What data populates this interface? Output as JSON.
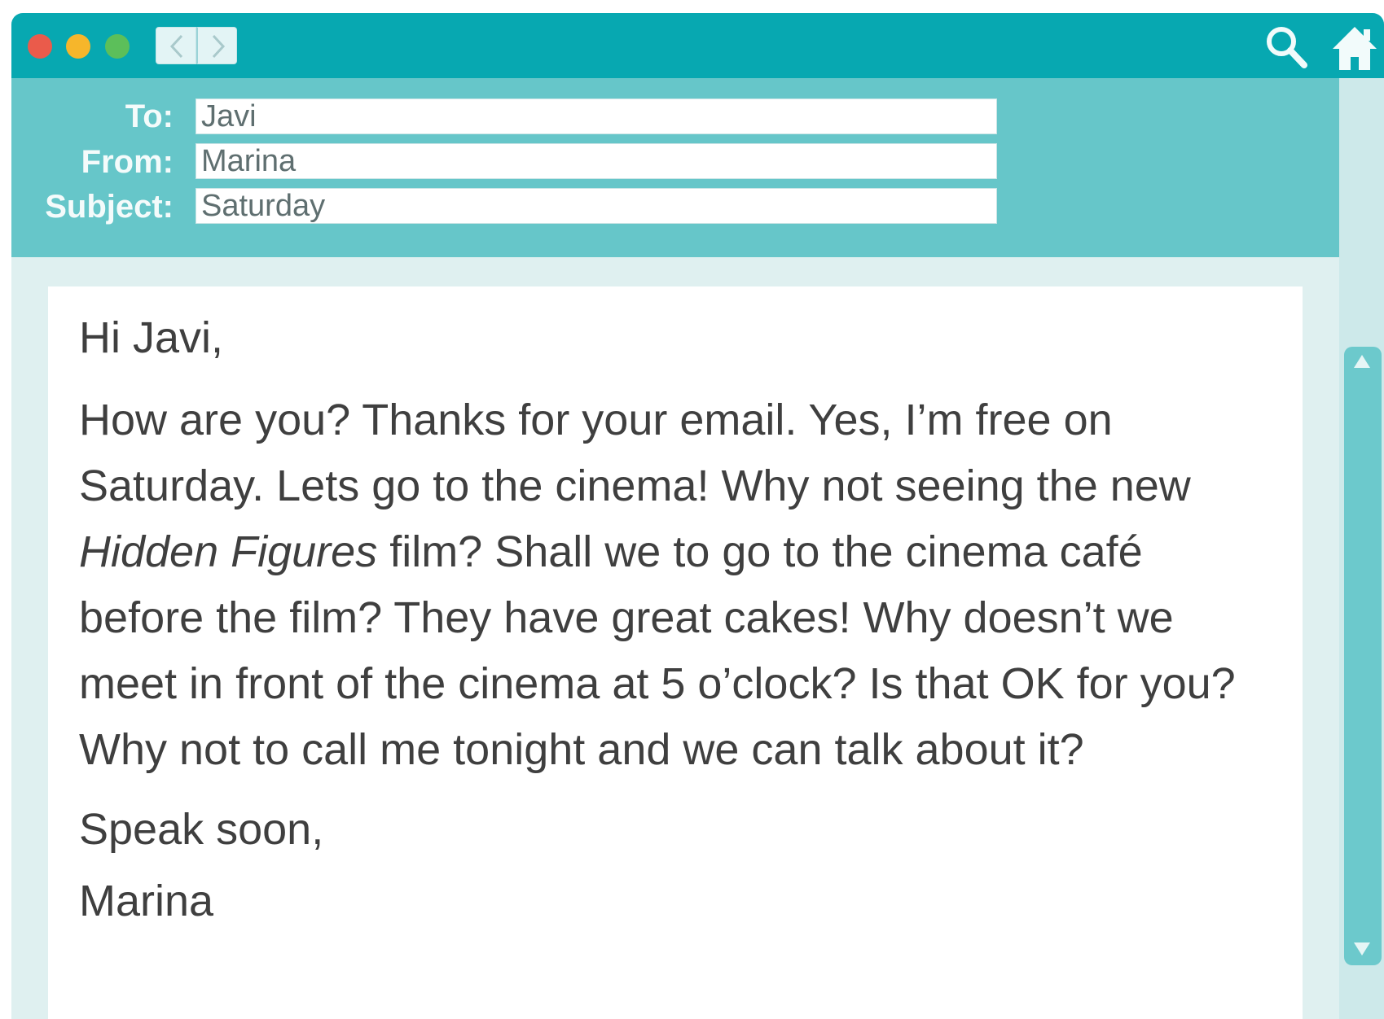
{
  "header": {
    "to_label": "To:",
    "to_value": "Javi",
    "from_label": "From:",
    "from_value": "Marina",
    "subject_label": "Subject:",
    "subject_value": "Saturday"
  },
  "body": {
    "greeting": "Hi Javi,",
    "paragraph_part1": "How are you? Thanks for your email. Yes, I’m free on Saturday. Lets go to the cinema! Why not seeing the new ",
    "paragraph_italic": "Hidden Figures",
    "paragraph_part2": " film? Shall we to go to the cinema café before the film? They have great cakes! Why doesn’t we meet in front of the cinema at 5 o’clock? Is that OK for you? Why not to call me tonight and we can talk about it?",
    "closing": "Speak soon,",
    "signature": "Marina"
  },
  "icons": {
    "search": "search-icon",
    "home": "home-icon",
    "back": "chevron-left-icon",
    "forward": "chevron-right-icon"
  },
  "colors": {
    "titlebar": "#07a8b1",
    "header": "#66c6c9",
    "window_bg": "#dff0f0",
    "close": "#ea5b4b",
    "minimize": "#f6b62b",
    "maximize": "#5cbf5a"
  }
}
